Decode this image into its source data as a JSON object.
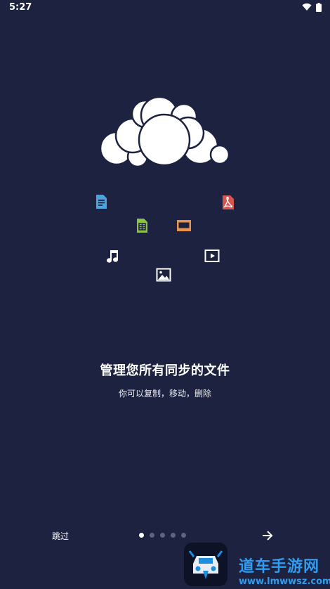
{
  "status_bar": {
    "time": "5:27",
    "icons": [
      "wifi-icon",
      "battery-icon"
    ]
  },
  "illustration": {
    "logo": "cloud-logo",
    "icons": [
      {
        "name": "document-icon",
        "color": "#4aa3df"
      },
      {
        "name": "pdf-icon",
        "color": "#d9534f"
      },
      {
        "name": "spreadsheet-icon",
        "color": "#8bc34a"
      },
      {
        "name": "presentation-icon",
        "color": "#e8944a"
      },
      {
        "name": "music-icon",
        "color": "#ffffff"
      },
      {
        "name": "video-icon",
        "color": "#ffffff"
      },
      {
        "name": "image-icon",
        "color": "#ffffff"
      }
    ]
  },
  "onboarding": {
    "title": "管理您所有同步的文件",
    "subtitle": "你可以复制，移动，删除"
  },
  "footer": {
    "skip_label": "跳过",
    "page_count": 5,
    "current_page": 1,
    "next_icon": "arrow-right-icon"
  },
  "watermark": {
    "title": "道车手游网",
    "url": "www.lmwwsz.com"
  },
  "colors": {
    "background": "#1d2240",
    "dot_inactive": "#5d6386",
    "dot_active": "#ffffff",
    "watermark": "#2f9cf0"
  }
}
